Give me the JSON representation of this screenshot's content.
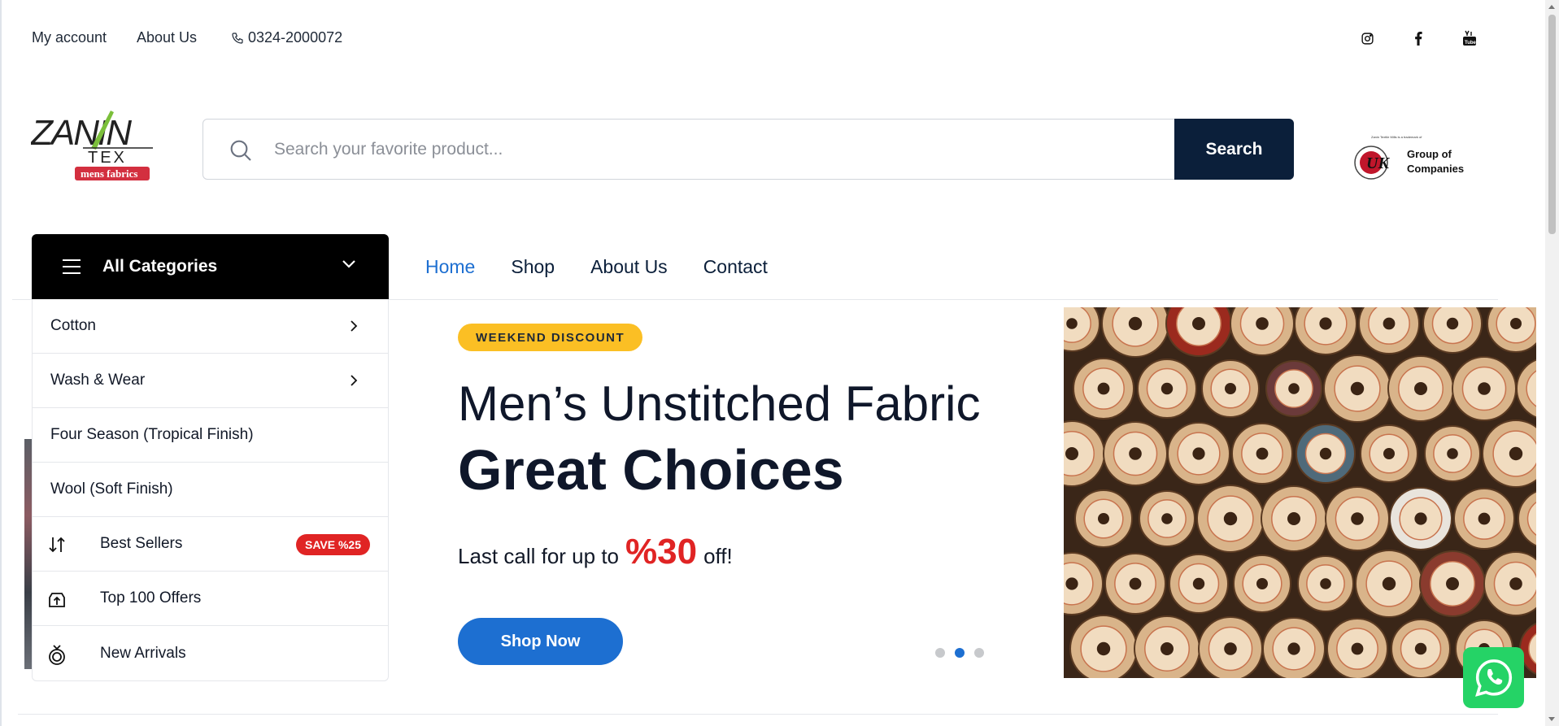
{
  "topbar": {
    "my_account": "My account",
    "about_us": "About Us",
    "phone": "0324-2000072",
    "social_icons": [
      "instagram-icon",
      "facebook-icon",
      "youtube-icon"
    ]
  },
  "header": {
    "logo_text": {
      "line1": "ZANIN",
      "line2": "TEX",
      "tag": "mens fabrics"
    },
    "search": {
      "placeholder": "Search your favorite product...",
      "button_label": "Search"
    },
    "partner_logo": {
      "tagline": "Zanin Textile Mills is a trademark of",
      "name_line1": "Group of",
      "name_line2": "Companies"
    }
  },
  "categories": {
    "title": "All Categories",
    "items": [
      {
        "label": "Cotton",
        "has_submenu": true
      },
      {
        "label": "Wash & Wear",
        "has_submenu": true
      },
      {
        "label": "Four Season (Tropical Finish)",
        "has_submenu": false
      },
      {
        "label": "Wool (Soft Finish)",
        "has_submenu": false
      },
      {
        "label": "Best Sellers",
        "icon": "sort-arrows-icon",
        "badge": "SAVE %25"
      },
      {
        "label": "Top 100 Offers",
        "icon": "upload-box-icon"
      },
      {
        "label": "New Arrivals",
        "icon": "ring-icon"
      }
    ]
  },
  "nav": {
    "items": [
      "Home",
      "Shop",
      "About Us",
      "Contact"
    ],
    "active": "Home"
  },
  "hero": {
    "badge": "WEEKEND DISCOUNT",
    "title_line1": "Men’s Unstitched Fabric",
    "title_line2": "Great Choices",
    "sub_prefix": "Last call for up to",
    "sub_percent": "%30",
    "sub_suffix": "off!",
    "cta": "Shop Now",
    "slide_count": 3,
    "active_slide": 2
  },
  "colors": {
    "accent_blue": "#1d6fd1",
    "navy": "#0b1f3a",
    "badge_yellow": "#fbbf24",
    "sale_red": "#e02424",
    "whatsapp_green": "#25d366"
  }
}
